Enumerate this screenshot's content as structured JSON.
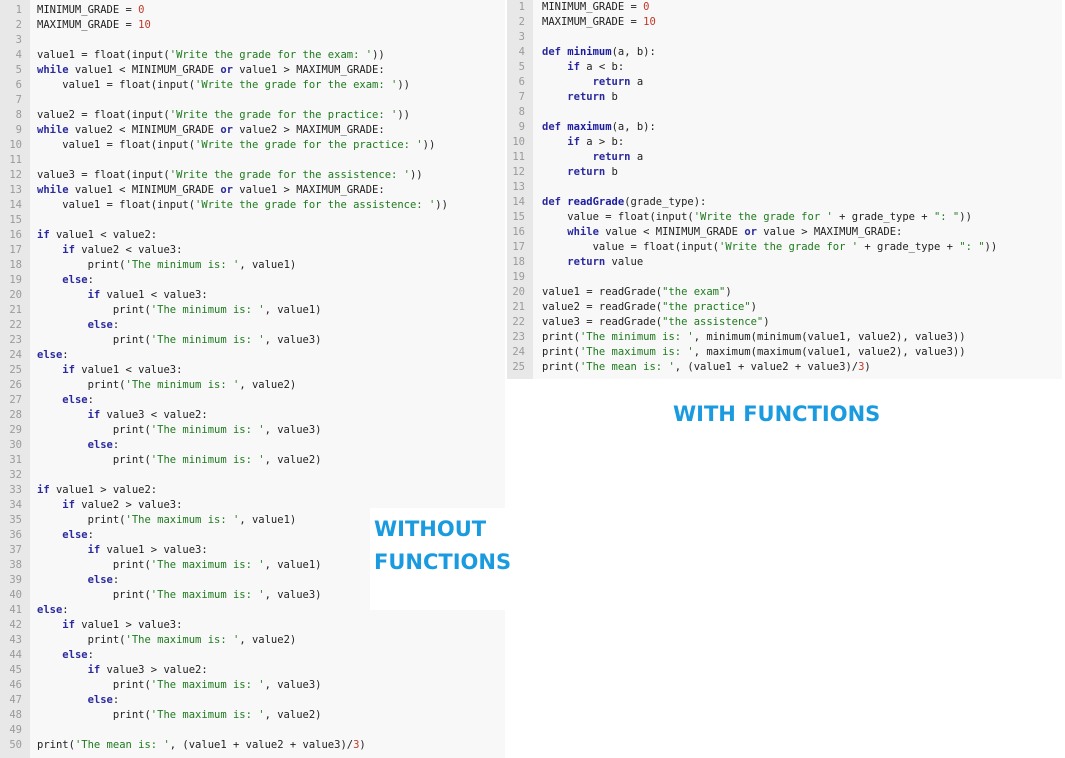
{
  "left": {
    "title_line1": "WITHOUT",
    "title_line2": "FUNCTIONS",
    "lines": [
      [
        [
          "MINIMUM_GRADE = ",
          ""
        ],
        [
          "0",
          "nm"
        ]
      ],
      [
        [
          "MAXIMUM_GRADE = ",
          ""
        ],
        [
          "10",
          "nm"
        ]
      ],
      [],
      [
        [
          "value1 = float(input(",
          ""
        ],
        [
          "'Write the grade for the exam: '",
          "st"
        ],
        [
          "))",
          ""
        ]
      ],
      [
        [
          "while",
          "kw"
        ],
        [
          " value1 < MINIMUM_GRADE ",
          ""
        ],
        [
          "or",
          "kw"
        ],
        [
          " value1 > MAXIMUM_GRADE:",
          ""
        ]
      ],
      [
        [
          "    value1 = float(input(",
          ""
        ],
        [
          "'Write the grade for the exam: '",
          "st"
        ],
        [
          "))",
          ""
        ]
      ],
      [],
      [
        [
          "value2 = float(input(",
          ""
        ],
        [
          "'Write the grade for the practice: '",
          "st"
        ],
        [
          "))",
          ""
        ]
      ],
      [
        [
          "while",
          "kw"
        ],
        [
          " value2 < MINIMUM_GRADE ",
          ""
        ],
        [
          "or",
          "kw"
        ],
        [
          " value2 > MAXIMUM_GRADE:",
          ""
        ]
      ],
      [
        [
          "    value1 = float(input(",
          ""
        ],
        [
          "'Write the grade for the practice: '",
          "st"
        ],
        [
          "))",
          ""
        ]
      ],
      [],
      [
        [
          "value3 = float(input(",
          ""
        ],
        [
          "'Write the grade for the assistence: '",
          "st"
        ],
        [
          "))",
          ""
        ]
      ],
      [
        [
          "while",
          "kw"
        ],
        [
          " value1 < MINIMUM_GRADE ",
          ""
        ],
        [
          "or",
          "kw"
        ],
        [
          " value1 > MAXIMUM_GRADE:",
          ""
        ]
      ],
      [
        [
          "    value1 = float(input(",
          ""
        ],
        [
          "'Write the grade for the assistence: '",
          "st"
        ],
        [
          "))",
          ""
        ]
      ],
      [],
      [
        [
          "if",
          "kw"
        ],
        [
          " value1 < value2:",
          ""
        ]
      ],
      [
        [
          "    ",
          ""
        ],
        [
          "if",
          "kw"
        ],
        [
          " value2 < value3:",
          ""
        ]
      ],
      [
        [
          "        print(",
          ""
        ],
        [
          "'The minimum is: '",
          "st"
        ],
        [
          ", value1)",
          ""
        ]
      ],
      [
        [
          "    ",
          ""
        ],
        [
          "else",
          "kw"
        ],
        [
          ":",
          ""
        ]
      ],
      [
        [
          "        ",
          ""
        ],
        [
          "if",
          "kw"
        ],
        [
          " value1 < value3:",
          ""
        ]
      ],
      [
        [
          "            print(",
          ""
        ],
        [
          "'The minimum is: '",
          "st"
        ],
        [
          ", value1)",
          ""
        ]
      ],
      [
        [
          "        ",
          ""
        ],
        [
          "else",
          "kw"
        ],
        [
          ":",
          ""
        ]
      ],
      [
        [
          "            print(",
          ""
        ],
        [
          "'The minimum is: '",
          "st"
        ],
        [
          ", value3)",
          ""
        ]
      ],
      [
        [
          "else",
          "kw"
        ],
        [
          ":",
          ""
        ]
      ],
      [
        [
          "    ",
          ""
        ],
        [
          "if",
          "kw"
        ],
        [
          " value1 < value3:",
          ""
        ]
      ],
      [
        [
          "        print(",
          ""
        ],
        [
          "'The minimum is: '",
          "st"
        ],
        [
          ", value2)",
          ""
        ]
      ],
      [
        [
          "    ",
          ""
        ],
        [
          "else",
          "kw"
        ],
        [
          ":",
          ""
        ]
      ],
      [
        [
          "        ",
          ""
        ],
        [
          "if",
          "kw"
        ],
        [
          " value3 < value2:",
          ""
        ]
      ],
      [
        [
          "            print(",
          ""
        ],
        [
          "'The minimum is: '",
          "st"
        ],
        [
          ", value3)",
          ""
        ]
      ],
      [
        [
          "        ",
          ""
        ],
        [
          "else",
          "kw"
        ],
        [
          ":",
          ""
        ]
      ],
      [
        [
          "            print(",
          ""
        ],
        [
          "'The minimum is: '",
          "st"
        ],
        [
          ", value2)",
          ""
        ]
      ],
      [],
      [
        [
          "if",
          "kw"
        ],
        [
          " value1 > value2:",
          ""
        ]
      ],
      [
        [
          "    ",
          ""
        ],
        [
          "if",
          "kw"
        ],
        [
          " value2 > value3:",
          ""
        ]
      ],
      [
        [
          "        print(",
          ""
        ],
        [
          "'The maximum is: '",
          "st"
        ],
        [
          ", value1)",
          ""
        ]
      ],
      [
        [
          "    ",
          ""
        ],
        [
          "else",
          "kw"
        ],
        [
          ":",
          ""
        ]
      ],
      [
        [
          "        ",
          ""
        ],
        [
          "if",
          "kw"
        ],
        [
          " value1 > value3:",
          ""
        ]
      ],
      [
        [
          "            print(",
          ""
        ],
        [
          "'The maximum is: '",
          "st"
        ],
        [
          ", value1)",
          ""
        ]
      ],
      [
        [
          "        ",
          ""
        ],
        [
          "else",
          "kw"
        ],
        [
          ":",
          ""
        ]
      ],
      [
        [
          "            print(",
          ""
        ],
        [
          "'The maximum is: '",
          "st"
        ],
        [
          ", value3)",
          ""
        ]
      ],
      [
        [
          "else",
          "kw"
        ],
        [
          ":",
          ""
        ]
      ],
      [
        [
          "    ",
          ""
        ],
        [
          "if",
          "kw"
        ],
        [
          " value1 > value3:",
          ""
        ]
      ],
      [
        [
          "        print(",
          ""
        ],
        [
          "'The maximum is: '",
          "st"
        ],
        [
          ", value2)",
          ""
        ]
      ],
      [
        [
          "    ",
          ""
        ],
        [
          "else",
          "kw"
        ],
        [
          ":",
          ""
        ]
      ],
      [
        [
          "        ",
          ""
        ],
        [
          "if",
          "kw"
        ],
        [
          " value3 > value2:",
          ""
        ]
      ],
      [
        [
          "            print(",
          ""
        ],
        [
          "'The maximum is: '",
          "st"
        ],
        [
          ", value3)",
          ""
        ]
      ],
      [
        [
          "        ",
          ""
        ],
        [
          "else",
          "kw"
        ],
        [
          ":",
          ""
        ]
      ],
      [
        [
          "            print(",
          ""
        ],
        [
          "'The maximum is: '",
          "st"
        ],
        [
          ", value2)",
          ""
        ]
      ],
      [],
      [
        [
          "print(",
          ""
        ],
        [
          "'The mean is: '",
          "st"
        ],
        [
          ", (value1 + value2 + value3)/",
          ""
        ],
        [
          "3",
          "nm"
        ],
        [
          ")",
          ""
        ]
      ]
    ]
  },
  "right": {
    "title": "WITH FUNCTIONS",
    "lines": [
      [
        [
          "MINIMUM_GRADE = ",
          ""
        ],
        [
          "0",
          "nm"
        ]
      ],
      [
        [
          "MAXIMUM_GRADE = ",
          ""
        ],
        [
          "10",
          "nm"
        ]
      ],
      [],
      [
        [
          "def",
          "kw"
        ],
        [
          " ",
          ""
        ],
        [
          "minimum",
          "fn"
        ],
        [
          "(a, b):",
          ""
        ]
      ],
      [
        [
          "    ",
          ""
        ],
        [
          "if",
          "kw"
        ],
        [
          " a < b:",
          ""
        ]
      ],
      [
        [
          "        ",
          ""
        ],
        [
          "return",
          "kw"
        ],
        [
          " a",
          ""
        ]
      ],
      [
        [
          "    ",
          ""
        ],
        [
          "return",
          "kw"
        ],
        [
          " b",
          ""
        ]
      ],
      [],
      [
        [
          "def",
          "kw"
        ],
        [
          " ",
          ""
        ],
        [
          "maximum",
          "fn"
        ],
        [
          "(a, b):",
          ""
        ]
      ],
      [
        [
          "    ",
          ""
        ],
        [
          "if",
          "kw"
        ],
        [
          " a > b:",
          ""
        ]
      ],
      [
        [
          "        ",
          ""
        ],
        [
          "return",
          "kw"
        ],
        [
          " a",
          ""
        ]
      ],
      [
        [
          "    ",
          ""
        ],
        [
          "return",
          "kw"
        ],
        [
          " b",
          ""
        ]
      ],
      [],
      [
        [
          "def",
          "kw"
        ],
        [
          " ",
          ""
        ],
        [
          "readGrade",
          "fn"
        ],
        [
          "(grade_type):",
          ""
        ]
      ],
      [
        [
          "    value = float(input(",
          ""
        ],
        [
          "'Write the grade for '",
          "st"
        ],
        [
          " + grade_type + ",
          ""
        ],
        [
          "\": \"",
          "st"
        ],
        [
          "))",
          ""
        ]
      ],
      [
        [
          "    ",
          ""
        ],
        [
          "while",
          "kw"
        ],
        [
          " value < MINIMUM_GRADE ",
          ""
        ],
        [
          "or",
          "kw"
        ],
        [
          " value > MAXIMUM_GRADE:",
          ""
        ]
      ],
      [
        [
          "        value = float(input(",
          ""
        ],
        [
          "'Write the grade for '",
          "st"
        ],
        [
          " + grade_type + ",
          ""
        ],
        [
          "\": \"",
          "st"
        ],
        [
          "))",
          ""
        ]
      ],
      [
        [
          "    ",
          ""
        ],
        [
          "return",
          "kw"
        ],
        [
          " value",
          ""
        ]
      ],
      [],
      [
        [
          "value1 = readGrade(",
          ""
        ],
        [
          "\"the exam\"",
          "st"
        ],
        [
          ")",
          ""
        ]
      ],
      [
        [
          "value2 = readGrade(",
          ""
        ],
        [
          "\"the practice\"",
          "st"
        ],
        [
          ")",
          ""
        ]
      ],
      [
        [
          "value3 = readGrade(",
          ""
        ],
        [
          "\"the assistence\"",
          "st"
        ],
        [
          ")",
          ""
        ]
      ],
      [
        [
          "print(",
          ""
        ],
        [
          "'The minimum is: '",
          "st"
        ],
        [
          ", minimum(minimum(value1, value2), value3))",
          ""
        ]
      ],
      [
        [
          "print(",
          ""
        ],
        [
          "'The maximum is: '",
          "st"
        ],
        [
          ", maximum(maximum(value1, value2), value3))",
          ""
        ]
      ],
      [
        [
          "print(",
          ""
        ],
        [
          "'The mean is: '",
          "st"
        ],
        [
          ", (value1 + value2 + value3)/",
          ""
        ],
        [
          "3",
          "nm"
        ],
        [
          ")",
          ""
        ]
      ]
    ]
  }
}
